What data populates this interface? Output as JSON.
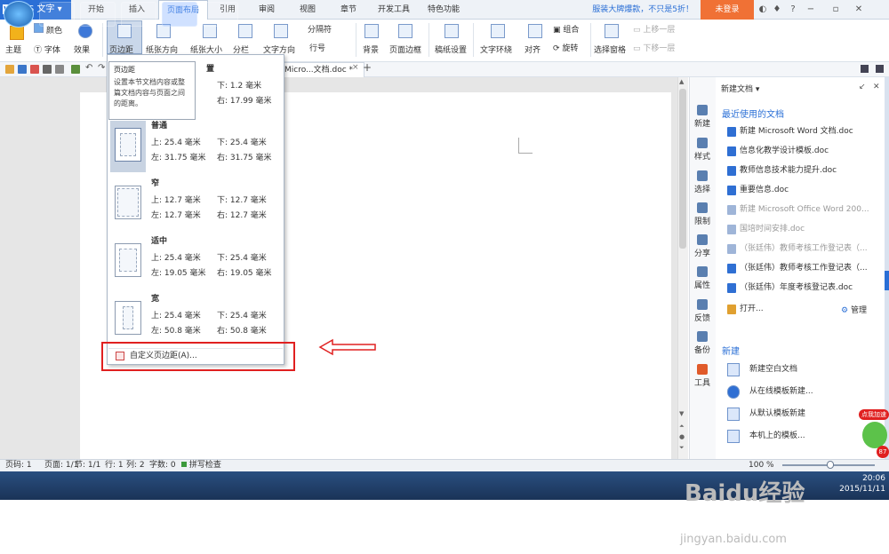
{
  "app": {
    "name": "WPS 文字"
  },
  "menu_tabs": [
    "开始",
    "插入",
    "页面布局",
    "引用",
    "审阅",
    "视图",
    "章节",
    "开发工具",
    "特色功能"
  ],
  "active_tab": "页面布局",
  "promo": "服装大牌爆款，不只是5折！",
  "login": "未登录",
  "ribbon": {
    "theme": "主题",
    "color": "颜色",
    "font": "字体",
    "effect": "效果",
    "margins": "页边距",
    "orientation": "纸张方向",
    "size": "纸张大小",
    "columns": "分栏",
    "text_dir": "文字方向",
    "breaks": "分隔符",
    "line_num": "行号",
    "background": "背景",
    "page_border": "页面边框",
    "draft": "稿纸设置",
    "wrap": "文字环绕",
    "align": "对齐",
    "group": "组合",
    "rotate": "旋转",
    "select_pane": "选择窗格",
    "bring_fwd": "上移一层",
    "send_back": "下移一层"
  },
  "doc_tab": "Micro...文档.doc *",
  "tooltip": {
    "title": "页边距",
    "body": "设置本节文档内容或整篇文档内容与页面之间的距离。"
  },
  "margin_menu": {
    "partial_title": "置",
    "partial_vals": [
      "下: 1.2 毫米",
      "右: 17.99 毫米"
    ],
    "items": [
      {
        "name": "普通",
        "top": "上: 25.4 毫米",
        "bottom": "下: 25.4 毫米",
        "left": "左: 31.75 毫米",
        "right": "右: 31.75 毫米"
      },
      {
        "name": "窄",
        "top": "上: 12.7 毫米",
        "bottom": "下: 12.7 毫米",
        "left": "左: 12.7 毫米",
        "right": "右: 12.7 毫米"
      },
      {
        "name": "适中",
        "top": "上: 25.4 毫米",
        "bottom": "下: 25.4 毫米",
        "left": "左: 19.05 毫米",
        "right": "右: 19.05 毫米"
      },
      {
        "name": "宽",
        "top": "上: 25.4 毫米",
        "bottom": "下: 25.4 毫米",
        "left": "左: 50.8 毫米",
        "right": "右: 50.8 毫米"
      }
    ],
    "custom": "自定义页边距(A)..."
  },
  "side_icons": [
    "新建",
    "样式",
    "选择",
    "限制",
    "分享",
    "属性",
    "反馈",
    "备份",
    "工具"
  ],
  "task_pane": {
    "title": "新建文档",
    "recent_head": "最近使用的文档",
    "recent": [
      {
        "name": "新建 Microsoft Word 文档.doc",
        "gray": false
      },
      {
        "name": "信息化教学设计模板.doc",
        "gray": false
      },
      {
        "name": "教师信息技术能力提升.doc",
        "gray": false
      },
      {
        "name": "重要信息.doc",
        "gray": false
      },
      {
        "name": "新建 Microsoft Office Word 200...",
        "gray": true
      },
      {
        "name": "国培时间安排.doc",
        "gray": true
      },
      {
        "name": "（张廷伟）教师考核工作登记表（...",
        "gray": true
      },
      {
        "name": "（张廷伟）教师考核工作登记表（...",
        "gray": false
      },
      {
        "name": "（张廷伟）年度考核登记表.doc",
        "gray": false
      }
    ],
    "open": "打开...",
    "manage": "管理",
    "new_head": "新建",
    "new_items": [
      "新建空白文档",
      "从在线模板新建...",
      "从默认模板新建",
      "本机上的模板..."
    ]
  },
  "badge": "点我加速",
  "badge_num": "87",
  "status": {
    "page": "页码: 1",
    "pages": "页面: 1/1",
    "section": "节: 1/1",
    "row": "行: 1",
    "col": "列: 2",
    "words": "字数: 0",
    "spell": "拼写检查",
    "zoom": "100 %"
  },
  "clock": {
    "time": "20:06",
    "date": "2015/11/11"
  },
  "watermark": {
    "brand": "Baidu经验",
    "url": "jingyan.baidu.com"
  }
}
